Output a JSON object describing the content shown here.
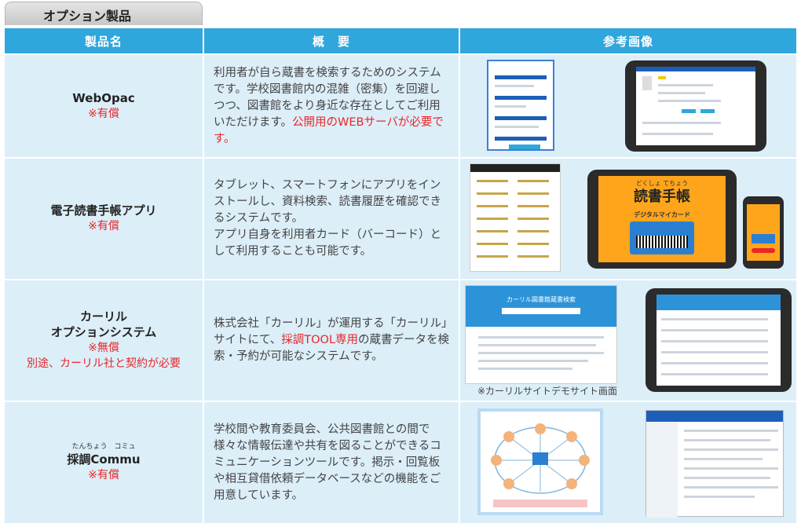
{
  "section_title": "オプション製品",
  "headers": {
    "name": "製品名",
    "summary": "概　要",
    "image": "参考画像"
  },
  "rows": [
    {
      "name_lines": [
        "WebOpac"
      ],
      "price": "※有償",
      "desc_parts": [
        {
          "text": "利用者が自ら蔵書を検索するためのシステムです。学校図書館内の混雑（密集）を回避しつつ、図書館をより身近な存在としてご利用いただけます。",
          "red": false
        },
        {
          "text": "公開用のWEBサーバが必要です。",
          "red": true
        }
      ]
    },
    {
      "name_lines": [
        "電子読書手帳アプリ"
      ],
      "price": "※有償",
      "desc_parts": [
        {
          "text": "タブレット、スマートフォンにアプリをインストールし、資料検索、読書履歴を確認できるシステムです。",
          "red": false
        },
        {
          "text": "\nアプリ自身を利用者カード（バーコード）として利用することも可能です。",
          "red": false
        }
      ],
      "app_title": "読書手帳",
      "app_title_ruby": "どくしょ てちょう",
      "app_card": "デジタルマイカード"
    },
    {
      "name_lines": [
        "カーリル",
        "オプションシステム"
      ],
      "price": "※無償",
      "note": "別途、カーリル社と契約が必要",
      "desc_parts": [
        {
          "text": "株式会社「カーリル」が運用する「カーリル」サイトにて、",
          "red": false
        },
        {
          "text": "採調TOOL専用",
          "red": true
        },
        {
          "text": "の蔵書データを検索・予約が可能なシステムです。",
          "red": false
        }
      ],
      "image_caption": "※カーリルサイトデモサイト画面",
      "screen_title": "カーリル図書館蔵書検索"
    },
    {
      "name_ruby": "たんちょう　コミュ",
      "name_lines": [
        "採調Commu"
      ],
      "price": "※有償",
      "desc_parts": [
        {
          "text": "学校間や教育委員会、公共図書館との間で様々な情報伝達や共有を図ることができるコミュニケーションツールです。掲示・回覧板や相互貸借依頼データベースなどの機能をご用意しています。",
          "red": false
        }
      ]
    }
  ],
  "colors": {
    "header": "#2fa6dc",
    "cell": "#dceef8",
    "red": "#e8262a",
    "orange": "#ffa51c"
  }
}
